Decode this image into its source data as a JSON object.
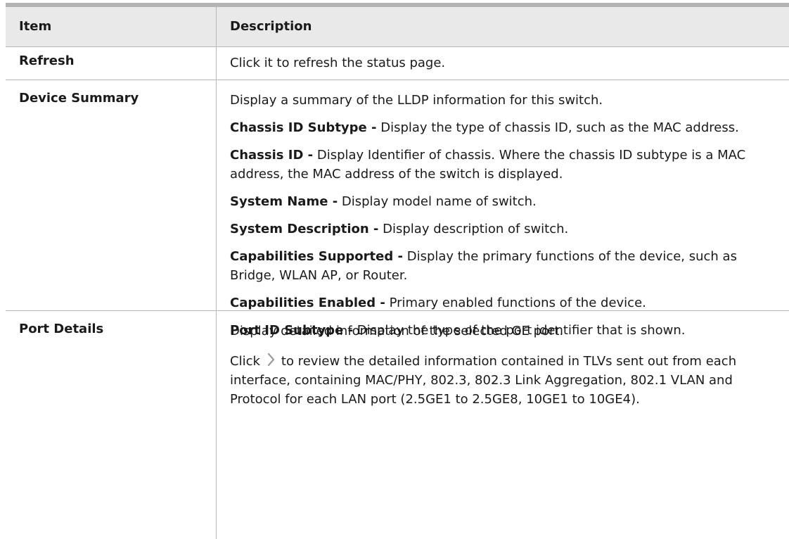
{
  "header": {
    "item": "Item",
    "description": "Description"
  },
  "rows": [
    {
      "item": "Refresh",
      "paragraphs": [
        {
          "label": "",
          "text": "Click it to refresh the status page."
        }
      ]
    },
    {
      "item": "Device Summary",
      "paragraphs": [
        {
          "label": "",
          "text": "Display a summary of the LLDP information for this switch."
        },
        {
          "label": "Chassis ID Subtype -",
          "text": " Display the type of chassis ID, such as the MAC address."
        },
        {
          "label": "Chassis ID -",
          "text": " Display Identifier of chassis. Where the chassis ID subtype is a MAC address, the MAC address of the switch is displayed."
        },
        {
          "label": "System Name -",
          "text": " Display model name of switch."
        },
        {
          "label": "System Description -",
          "text": " Display description of switch."
        },
        {
          "label": "Capabilities Supported -",
          "text": " Display the primary functions of the device, such as Bridge, WLAN AP, or Router."
        },
        {
          "label": "Capabilities Enabled -",
          "text": " Primary enabled functions of the device."
        },
        {
          "label": "Port ID Subtype -",
          "text": " Display the type of the port identifier that is shown."
        }
      ]
    },
    {
      "item": "Port Details",
      "intro": "Display detailed information of the selected GE port.",
      "click_prefix": "Click",
      "click_suffix": "to review the detailed information contained in TLVs sent out from each interface, containing MAC/PHY, 802.3, 802.3 Link Aggregation, 802.1 VLAN and Protocol for each LAN port (2.5GE1 to 2.5GE8, 10GE1 to 10GE4).",
      "icon": "chevron-right-icon"
    }
  ],
  "colors": {
    "header_bg": "#e9e9e9",
    "rule": "#b4b4b4",
    "icon": "#9a9a9a"
  }
}
